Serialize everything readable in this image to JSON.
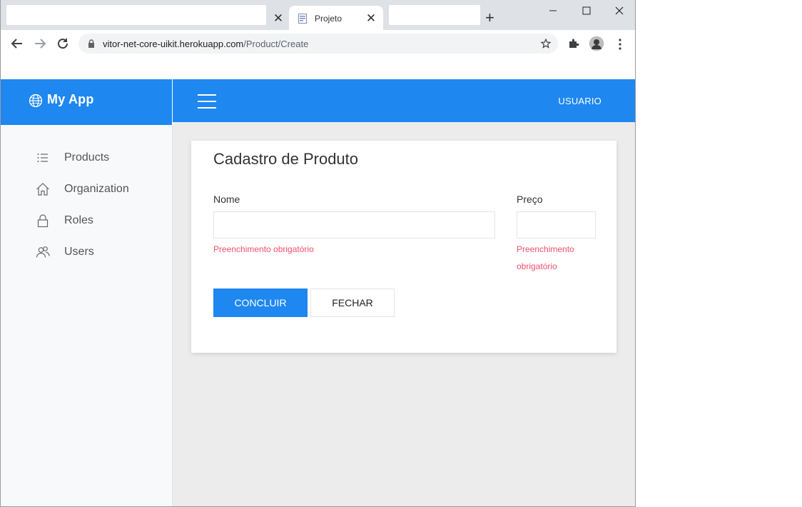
{
  "browser": {
    "tabs": [
      {
        "title": "",
        "close": "✕"
      },
      {
        "title": "Projeto",
        "close": "✕",
        "active": true
      },
      {
        "title": ""
      }
    ],
    "new_tab": "+",
    "address": {
      "host": "vitor-net-core-uikit.herokuapp.com",
      "path": "/Product/Create"
    },
    "icons": [
      "back-icon",
      "forward-icon",
      "reload-icon",
      "lock-icon",
      "star-icon",
      "extensions-icon",
      "profile-avatar",
      "menu-icon",
      "minimize-icon",
      "maximize-icon",
      "close-window-icon"
    ]
  },
  "app": {
    "brand": "My App",
    "user": "USUARIO",
    "accent": "#1e87f0",
    "sidebar": {
      "items": [
        {
          "label": "Products",
          "icon": "list-icon"
        },
        {
          "label": "Organization",
          "icon": "home-icon"
        },
        {
          "label": "Roles",
          "icon": "lock-icon"
        },
        {
          "label": "Users",
          "icon": "users-icon"
        }
      ]
    }
  },
  "form": {
    "title": "Cadastro de Produto",
    "nome": {
      "label": "Nome",
      "value": "",
      "error": "Preenchimento obrigatório"
    },
    "preco": {
      "label": "Preço",
      "value": "",
      "error_line1": "Preenchimento",
      "error_line2": "obrigatório"
    },
    "error_color": "#f0506e",
    "submit": "CONCLUIR",
    "close": "FECHAR"
  }
}
